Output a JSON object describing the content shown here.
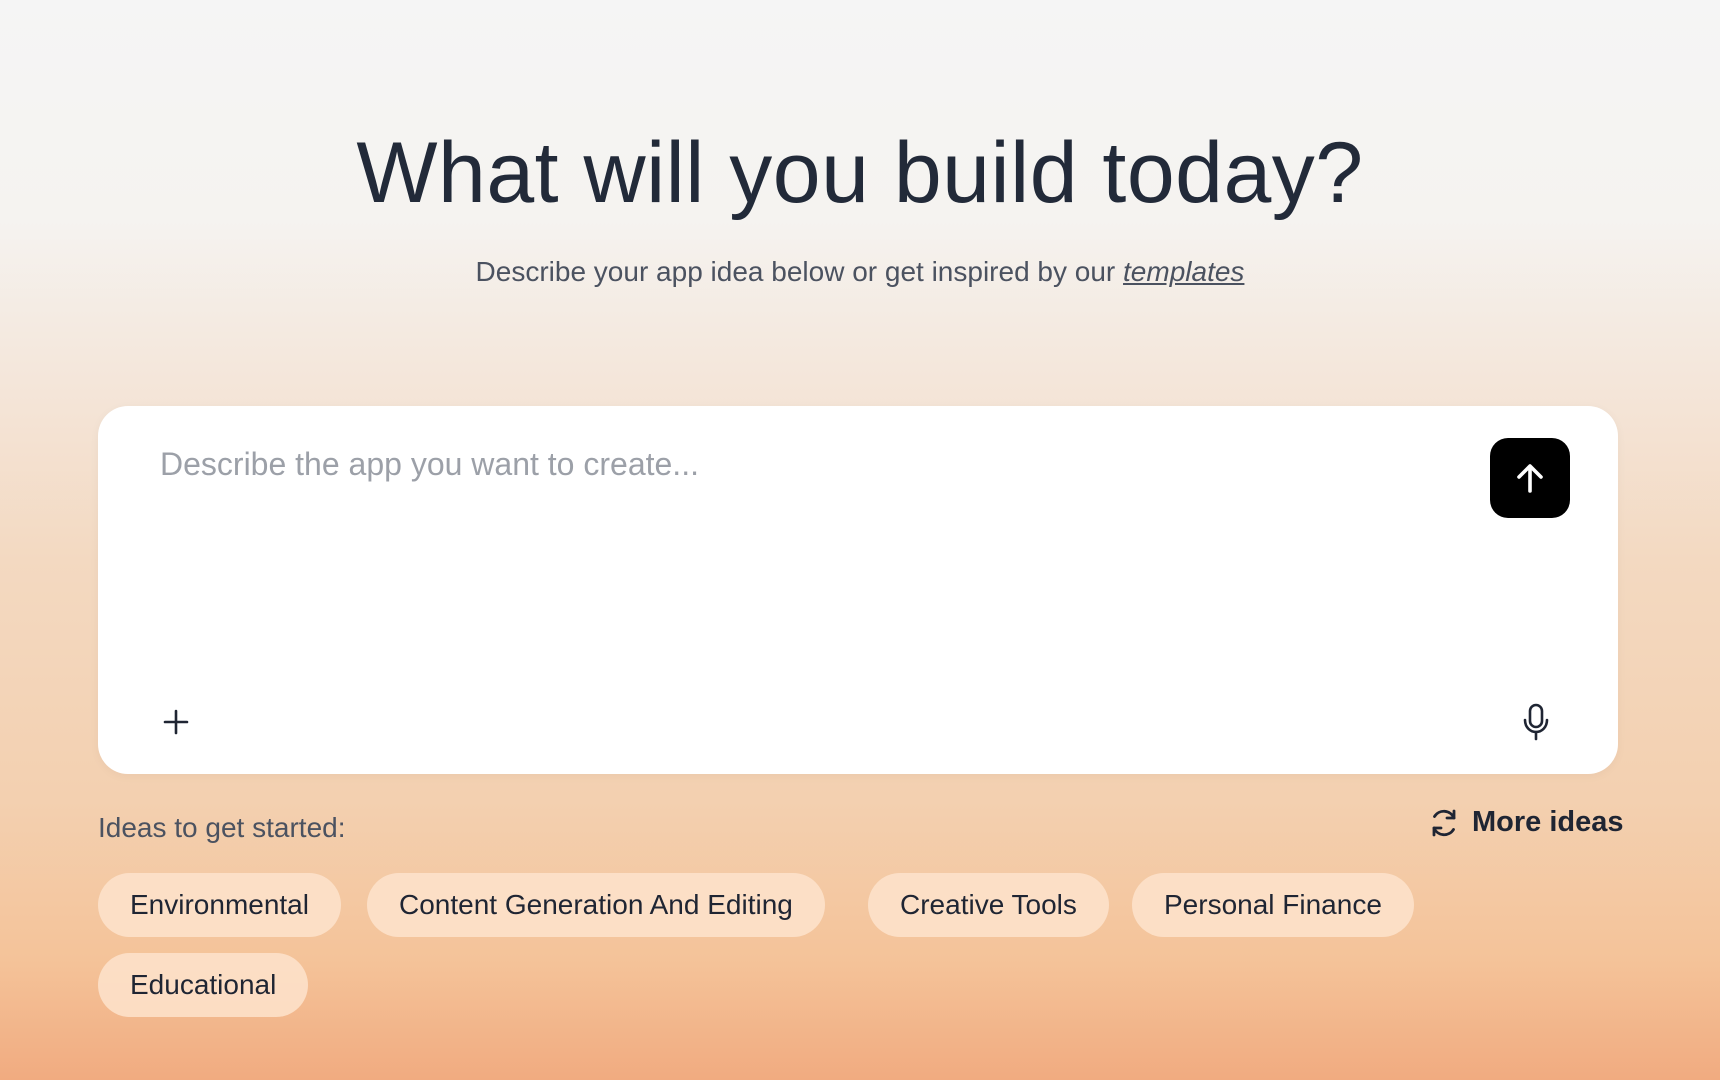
{
  "hero": {
    "title": "What will you build today?",
    "subtitle_prefix": "Describe your app idea below or get inspired by our ",
    "subtitle_link": "templates"
  },
  "prompt": {
    "placeholder": "Describe the app you want to create...",
    "value": ""
  },
  "icons": {
    "send": "arrow-up-icon",
    "attach": "plus-icon",
    "mic": "microphone-icon",
    "refresh": "refresh-icon"
  },
  "ideas": {
    "label": "Ideas to get started:",
    "more_label": "More ideas",
    "chips": [
      "Environmental",
      "Content Generation And Editing",
      "Creative Tools",
      "Personal Finance",
      "Educational"
    ]
  },
  "colors": {
    "send_button": "#000000",
    "card": "#ffffff",
    "chip": "#fde3cd",
    "title": "#222a39"
  }
}
